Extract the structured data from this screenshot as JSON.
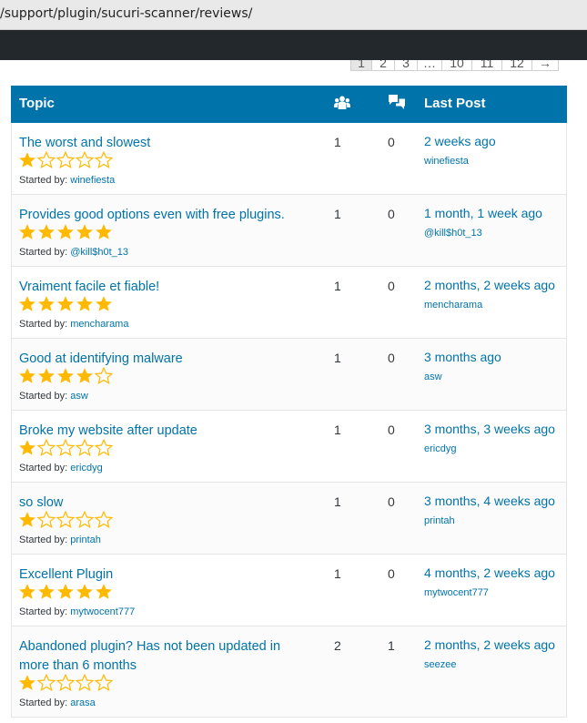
{
  "browser": {
    "url": "/support/plugin/sucuri-scanner/reviews/"
  },
  "pagination": {
    "items": [
      {
        "label": "1",
        "current": true
      },
      {
        "label": "2"
      },
      {
        "label": "3"
      },
      {
        "label": "…"
      },
      {
        "label": "10"
      },
      {
        "label": "11"
      },
      {
        "label": "12"
      },
      {
        "label": "→"
      }
    ]
  },
  "table": {
    "header": {
      "topic": "Topic",
      "voices_icon": "voices-icon",
      "replies_icon": "replies-icon",
      "last_post": "Last Post"
    },
    "started_by_label": "Started by:",
    "star_colors": {
      "full": "#ffb900",
      "empty_outline": "#ffb900"
    },
    "rows": [
      {
        "title": "The worst and slowest",
        "rating": 1,
        "author": "winefiesta",
        "voices": "1",
        "replies": "0",
        "freshness": "2 weeks ago",
        "last_author": "winefiesta"
      },
      {
        "title": "Provides good options even with free plugins.",
        "rating": 5,
        "author": "@kill$h0t_13",
        "voices": "1",
        "replies": "0",
        "freshness": "1 month, 1 week ago",
        "last_author": "@kill$h0t_13"
      },
      {
        "title": "Vraiment facile et fiable!",
        "rating": 5,
        "author": "mencharama",
        "voices": "1",
        "replies": "0",
        "freshness": "2 months, 2 weeks ago",
        "last_author": "mencharama"
      },
      {
        "title": "Good at identifying malware",
        "rating": 4,
        "author": "asw",
        "voices": "1",
        "replies": "0",
        "freshness": "3 months ago",
        "last_author": "asw"
      },
      {
        "title": "Broke my website after update",
        "rating": 1,
        "author": "ericdyg",
        "voices": "1",
        "replies": "0",
        "freshness": "3 months, 3 weeks ago",
        "last_author": "ericdyg"
      },
      {
        "title": "so slow",
        "rating": 1,
        "author": "printah",
        "voices": "1",
        "replies": "0",
        "freshness": "3 months, 4 weeks ago",
        "last_author": "printah"
      },
      {
        "title": "Excellent Plugin",
        "rating": 5,
        "author": "mytwocent777",
        "voices": "1",
        "replies": "0",
        "freshness": "4 months, 2 weeks ago",
        "last_author": "mytwocent777"
      },
      {
        "title": "Abandoned plugin? Has not been updated in more than 6 months",
        "rating": 1,
        "author": "arasa",
        "voices": "2",
        "replies": "1",
        "freshness": "2 months, 2 weeks ago",
        "last_author": "seezee",
        "tall": true
      }
    ]
  }
}
